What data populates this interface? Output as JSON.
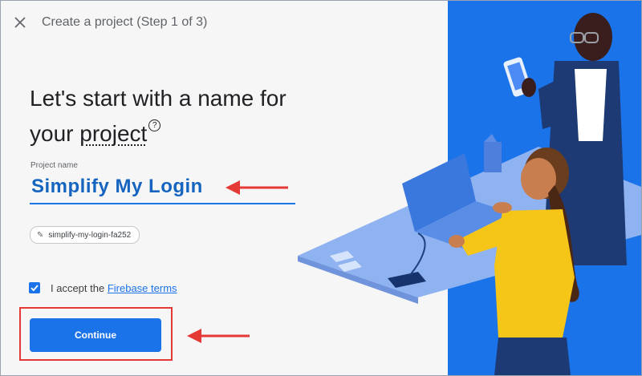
{
  "dialog": {
    "title": "Create a project (Step 1 of 3)",
    "close_icon": "close-icon"
  },
  "headline": {
    "line1": "Let's start with a name for",
    "line2_prefix": "your ",
    "line2_link": "project",
    "help_icon": "help-icon",
    "help_glyph": "?"
  },
  "project_name": {
    "label": "Project name",
    "value": "Simplify My Login"
  },
  "project_id": {
    "icon": "pencil-icon",
    "value": "simplify-my-login-fa252"
  },
  "terms": {
    "checked": true,
    "prefix": "I accept the ",
    "link": "Firebase terms"
  },
  "continue_button": {
    "label": "Continue"
  },
  "colors": {
    "accent": "#1a73e8",
    "annotation": "#e53935",
    "project_name_text": "#1565c0"
  }
}
